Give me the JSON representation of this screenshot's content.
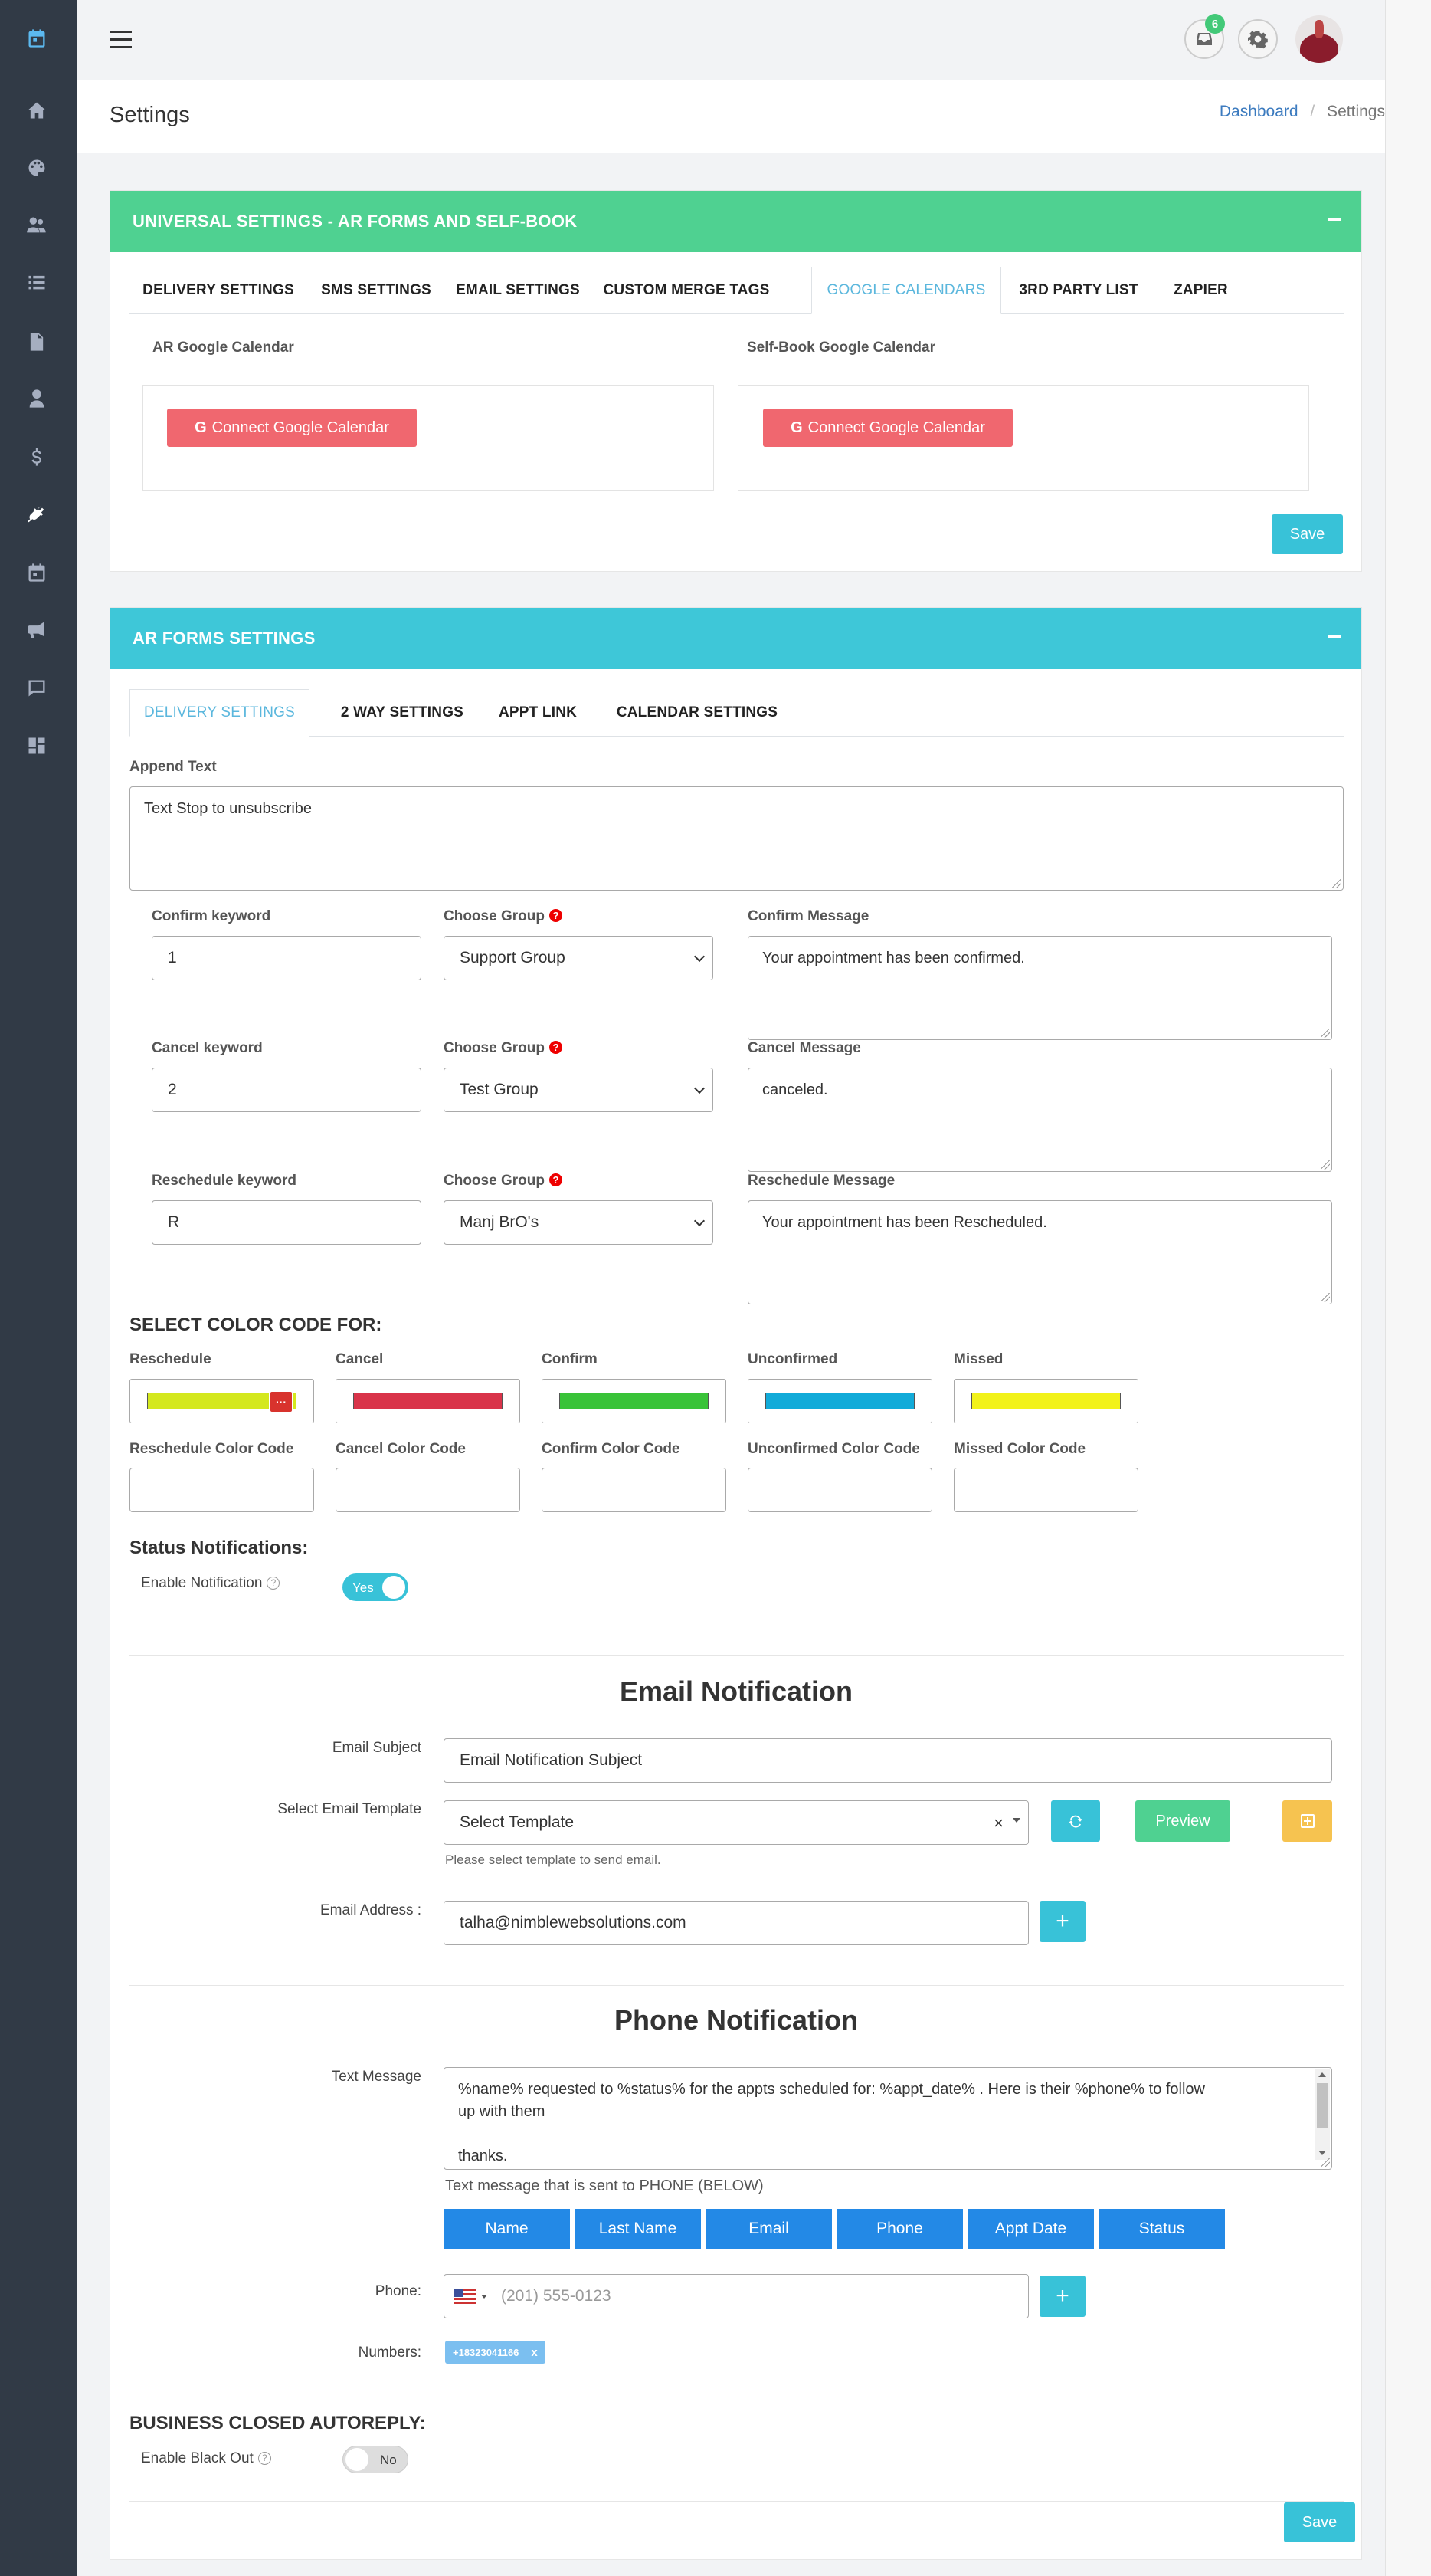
{
  "sidebar": {
    "items": [
      {
        "icon": "calendar-icon",
        "active": true
      },
      {
        "icon": "home-icon"
      },
      {
        "icon": "palette-icon"
      },
      {
        "icon": "users-icon"
      },
      {
        "icon": "list-icon"
      },
      {
        "icon": "file-icon"
      },
      {
        "icon": "user-icon"
      },
      {
        "icon": "dollar-icon"
      },
      {
        "icon": "plug-icon",
        "active": true
      },
      {
        "icon": "calendar-small-icon"
      },
      {
        "icon": "megaphone-icon"
      },
      {
        "icon": "chat-icon"
      },
      {
        "icon": "dashboard-icon"
      }
    ]
  },
  "topbar": {
    "notification_count": "6"
  },
  "header": {
    "title": "Settings",
    "breadcrumb": {
      "home": "Dashboard",
      "separator": "/",
      "current": "Settings"
    }
  },
  "universal": {
    "title": "UNIVERSAL SETTINGS - AR FORMS AND SELF-BOOK",
    "tabs": [
      "DELIVERY SETTINGS",
      "SMS SETTINGS",
      "EMAIL SETTINGS",
      "CUSTOM MERGE TAGS",
      "GOOGLE CALENDARS",
      "3RD PARTY LIST",
      "ZAPIER"
    ],
    "active_tab": "GOOGLE CALENDARS",
    "ar_calendar_label": "AR Google Calendar",
    "selfbook_calendar_label": "Self-Book Google Calendar",
    "connect_label": "Connect Google Calendar",
    "save_label": "Save"
  },
  "arforms": {
    "title": "AR FORMS SETTINGS",
    "tabs": [
      "DELIVERY SETTINGS",
      "2 WAY SETTINGS",
      "APPT LINK",
      "CALENDAR SETTINGS"
    ],
    "active_tab": "DELIVERY SETTINGS",
    "append_label": "Append Text",
    "append_value": "Text Stop to unsubscribe",
    "keywords": [
      {
        "kw_label": "Confirm keyword",
        "kw_value": "1",
        "group_label": "Choose Group",
        "group_value": "Support Group",
        "msg_label": "Confirm Message",
        "msg_value": "Your appointment has been confirmed."
      },
      {
        "kw_label": "Cancel keyword",
        "kw_value": "2",
        "group_label": "Choose Group",
        "group_value": "Test Group",
        "msg_label": "Cancel Message",
        "msg_value": "canceled."
      },
      {
        "kw_label": "Reschedule keyword",
        "kw_value": "R",
        "group_label": "Choose Group",
        "group_value": "Manj BrO's",
        "msg_label": "Reschedule Message",
        "msg_value": "Your appointment has been Rescheduled."
      }
    ],
    "color_heading": "SELECT COLOR CODE FOR:",
    "colors": [
      {
        "label": "Reschedule",
        "color": "#d4e81e",
        "code_label": "Reschedule Color Code"
      },
      {
        "label": "Cancel",
        "color": "#d9344a",
        "code_label": "Cancel Color Code"
      },
      {
        "label": "Confirm",
        "color": "#39c338",
        "code_label": "Confirm Color Code"
      },
      {
        "label": "Unconfirmed",
        "color": "#12abd9",
        "code_label": "Unconfirmed Color Code"
      },
      {
        "label": "Missed",
        "color": "#f2f21a",
        "code_label": "Missed Color Code"
      }
    ],
    "status_heading": "Status Notifications:",
    "enable_notification_label": "Enable Notification",
    "toggle_yes": "Yes",
    "email_heading": "Email Notification",
    "email_subject_label": "Email Subject",
    "email_subject_value": "Email Notification Subject",
    "template_label": "Select Email Template",
    "template_value": "Select Template",
    "template_clear": "×",
    "template_help": "Please select template to send email.",
    "preview_label": "Preview",
    "email_address_label": "Email Address :",
    "email_address_value": "talha@nimblewebsolutions.com",
    "phone_heading": "Phone Notification",
    "text_message_label": "Text Message",
    "text_message_line1": "%name%  requested to %status%  for the appts scheduled for: %appt_date% . Here is their %phone% to follow",
    "text_message_line2": "up with them",
    "text_message_line3": "thanks.",
    "text_message_help": "Text message that is sent to PHONE (BELOW)",
    "merge_buttons": [
      "Name",
      "Last Name",
      "Email",
      "Phone",
      "Appt Date",
      "Status"
    ],
    "phone_label": "Phone:",
    "phone_placeholder": "(201) 555-0123",
    "numbers_label": "Numbers:",
    "number_tag": "+18323041166",
    "number_tag_remove": "x",
    "closed_heading": "BUSINESS CLOSED AUTOREPLY:",
    "blackout_label": "Enable Black Out",
    "toggle_no": "No",
    "save_label": "Save"
  },
  "colors": {
    "green_header": "#4fd191",
    "cyan_header": "#3ec7d8",
    "danger": "#f0676f",
    "cyan": "#38c2d8",
    "blue": "#2389e6",
    "orange": "#f6c350"
  }
}
